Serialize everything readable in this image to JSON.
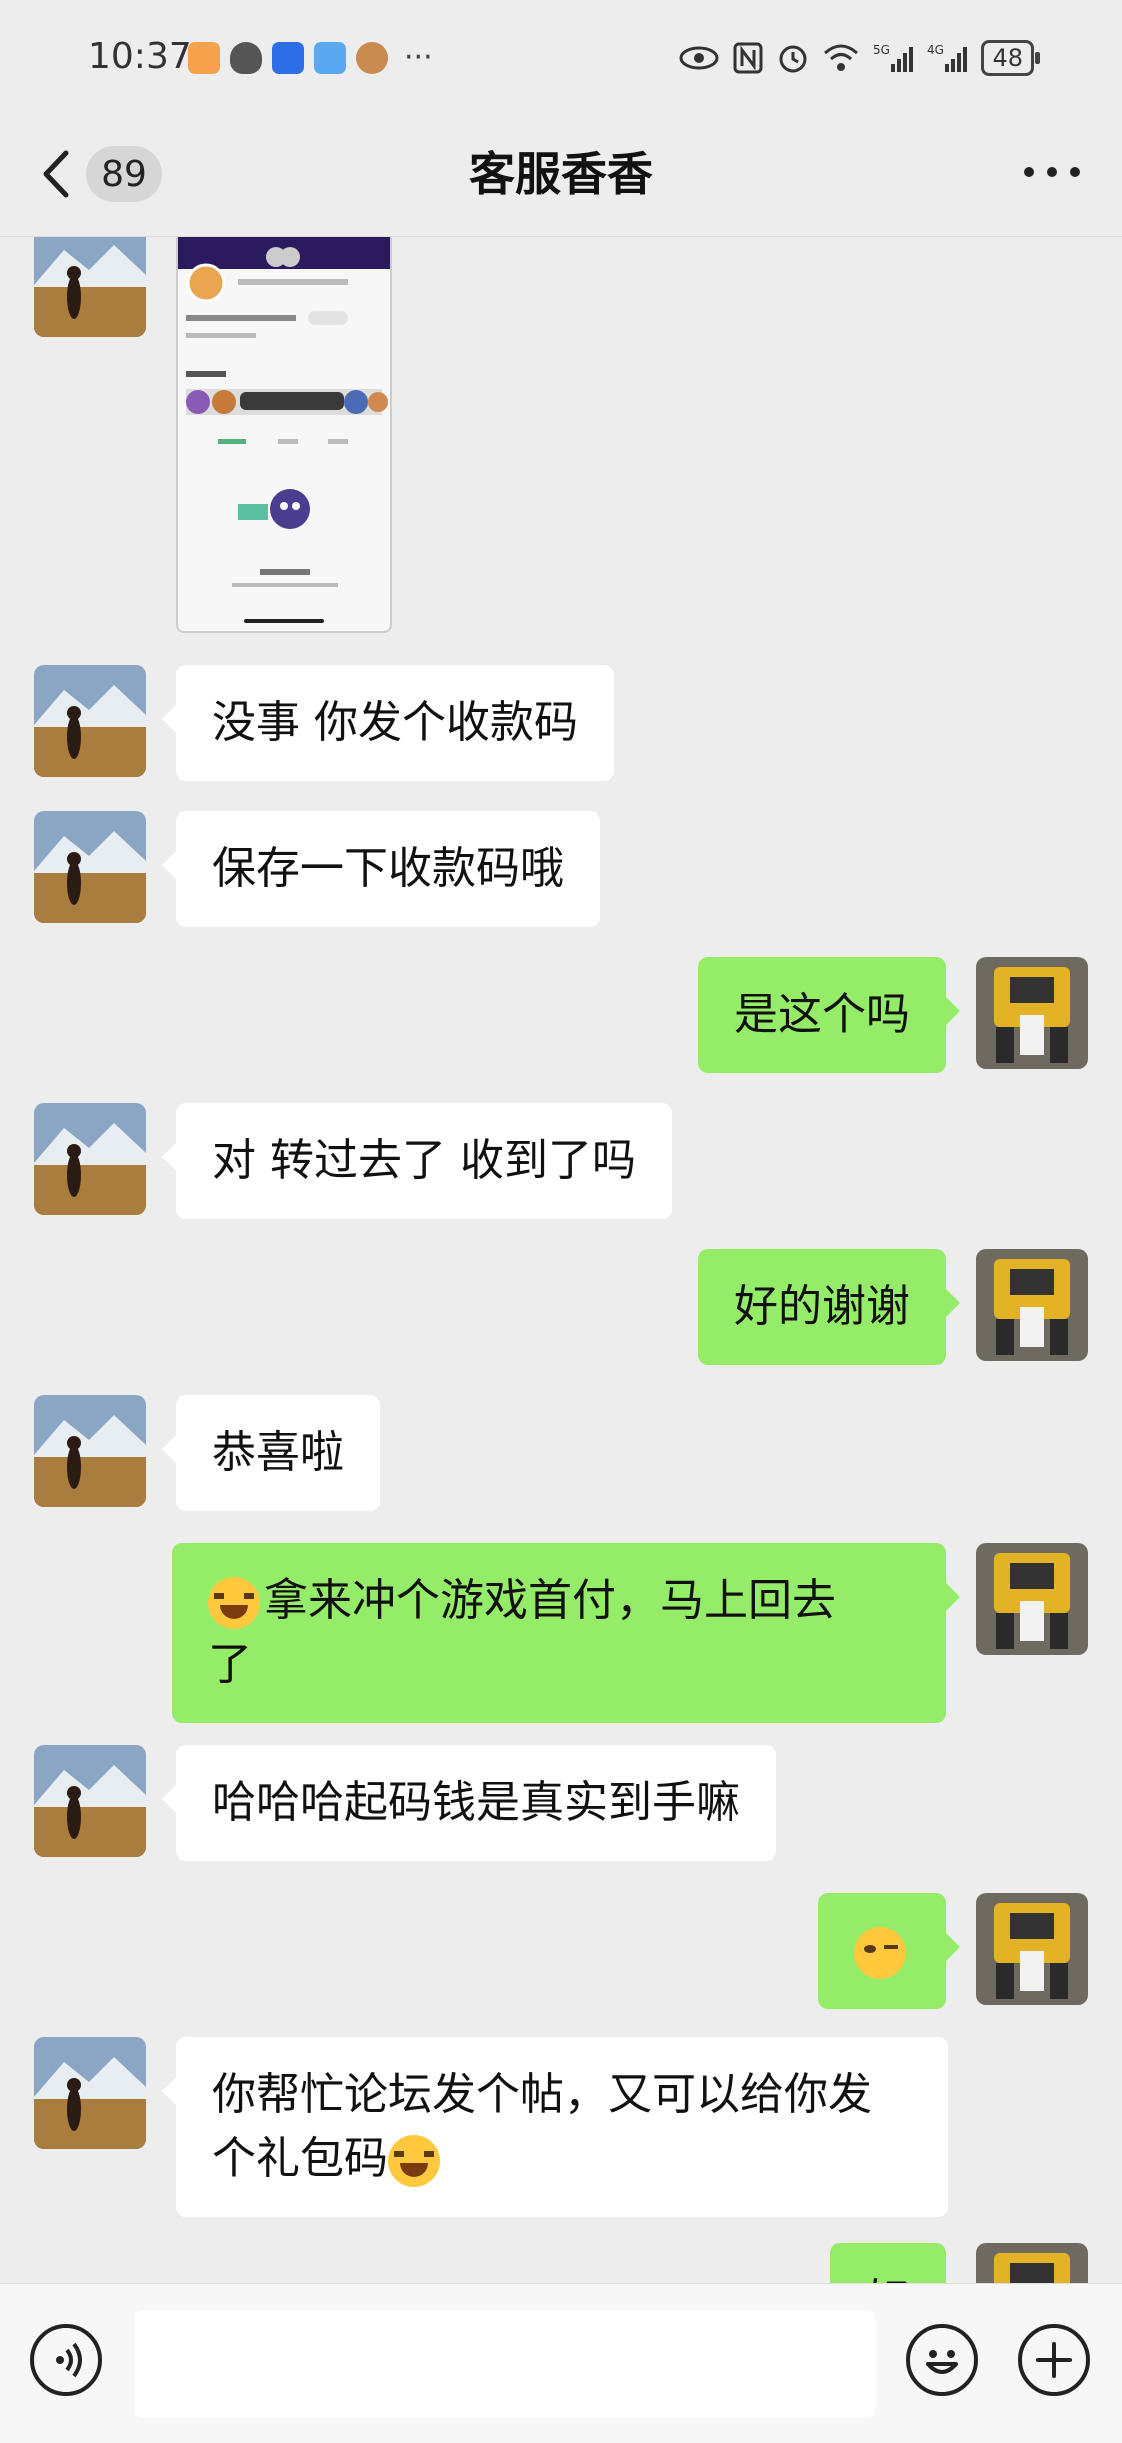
{
  "status_bar": {
    "time": "10:37",
    "left_icons": [
      "taobao-icon",
      "qq-icon",
      "app-icon",
      "weather-icon",
      "monkey-app-icon"
    ],
    "more_dots": "···",
    "right_icons": [
      "eye-icon",
      "nfc-icon",
      "alarm-icon",
      "wifi-icon",
      "5g-signal-icon",
      "4g-signal-icon"
    ],
    "battery": "48"
  },
  "header": {
    "unread_count": "89",
    "title": "客服香香"
  },
  "messages": [
    {
      "side": "in",
      "type": "image"
    },
    {
      "side": "in",
      "text": "没事 你发个收款码"
    },
    {
      "side": "in",
      "text": "保存一下收款码哦"
    },
    {
      "side": "out",
      "text": "是这个吗"
    },
    {
      "side": "in",
      "text": "对 转过去了 收到了吗"
    },
    {
      "side": "out",
      "text": "好的谢谢"
    },
    {
      "side": "in",
      "text": "恭喜啦"
    },
    {
      "side": "out",
      "text_line1": "拿来冲个游戏首付，马上回去",
      "text_line2": "了",
      "emoji": "cry-laugh-emoji"
    },
    {
      "side": "in",
      "text": "哈哈哈起码钱是真实到手嘛"
    },
    {
      "side": "out",
      "emoji": "smirk-emoji"
    },
    {
      "side": "in",
      "text_line1": "你帮忙论坛发个帖，又可以给你发",
      "text_line2": "个礼包码",
      "emoji": "laugh-tears-emoji"
    },
    {
      "side": "out",
      "text": "好"
    }
  ],
  "colors": {
    "background": "#ededed",
    "outgoing_bubble": "#95ec69",
    "incoming_bubble": "#ffffff"
  }
}
